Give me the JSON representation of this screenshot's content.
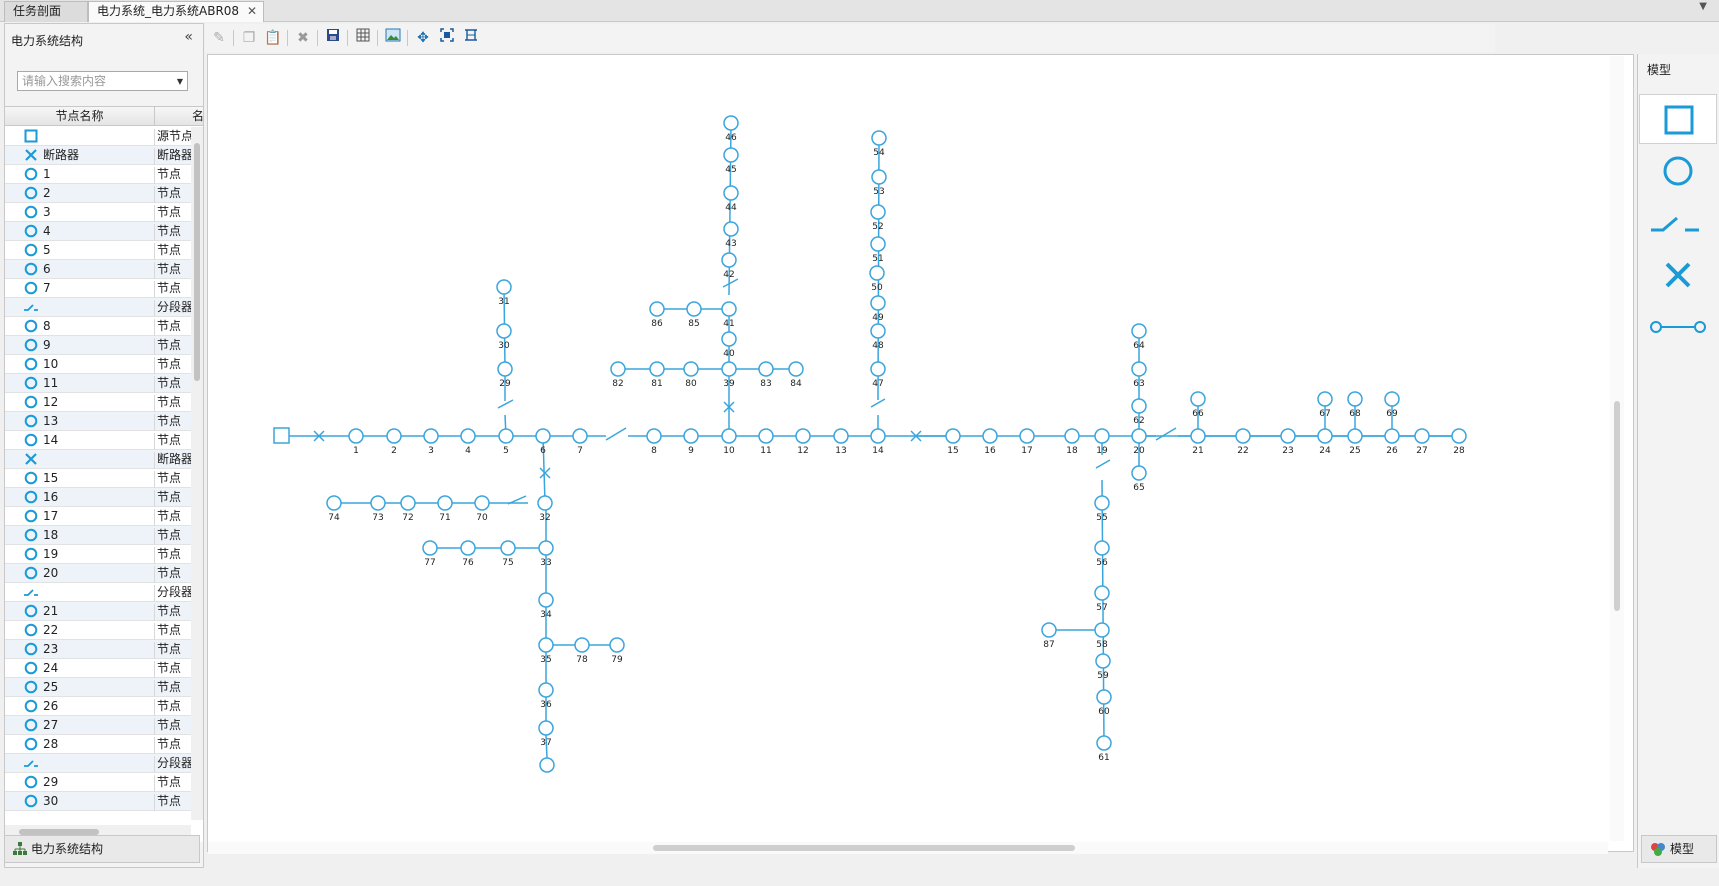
{
  "tabs": [
    {
      "label": "任务剖面"
    },
    {
      "label": "电力系统_电力系统ABR08"
    }
  ],
  "left_panel": {
    "title": "电力系统结构",
    "search_placeholder": "请输入搜索内容",
    "col_name": "节点名称",
    "col_type": "名",
    "rows": [
      {
        "icon": "square",
        "name": "",
        "type": "源节点"
      },
      {
        "icon": "x",
        "name": "断路器",
        "type": "断路器"
      },
      {
        "icon": "circle",
        "name": "1",
        "type": "节点"
      },
      {
        "icon": "circle",
        "name": "2",
        "type": "节点"
      },
      {
        "icon": "circle",
        "name": "3",
        "type": "节点"
      },
      {
        "icon": "circle",
        "name": "4",
        "type": "节点"
      },
      {
        "icon": "circle",
        "name": "5",
        "type": "节点"
      },
      {
        "icon": "circle",
        "name": "6",
        "type": "节点"
      },
      {
        "icon": "circle",
        "name": "7",
        "type": "节点"
      },
      {
        "icon": "switch",
        "name": "",
        "type": "分段器"
      },
      {
        "icon": "circle",
        "name": "8",
        "type": "节点"
      },
      {
        "icon": "circle",
        "name": "9",
        "type": "节点"
      },
      {
        "icon": "circle",
        "name": "10",
        "type": "节点"
      },
      {
        "icon": "circle",
        "name": "11",
        "type": "节点"
      },
      {
        "icon": "circle",
        "name": "12",
        "type": "节点"
      },
      {
        "icon": "circle",
        "name": "13",
        "type": "节点"
      },
      {
        "icon": "circle",
        "name": "14",
        "type": "节点"
      },
      {
        "icon": "x",
        "name": "",
        "type": "断路器"
      },
      {
        "icon": "circle",
        "name": "15",
        "type": "节点"
      },
      {
        "icon": "circle",
        "name": "16",
        "type": "节点"
      },
      {
        "icon": "circle",
        "name": "17",
        "type": "节点"
      },
      {
        "icon": "circle",
        "name": "18",
        "type": "节点"
      },
      {
        "icon": "circle",
        "name": "19",
        "type": "节点"
      },
      {
        "icon": "circle",
        "name": "20",
        "type": "节点"
      },
      {
        "icon": "switch",
        "name": "",
        "type": "分段器"
      },
      {
        "icon": "circle",
        "name": "21",
        "type": "节点"
      },
      {
        "icon": "circle",
        "name": "22",
        "type": "节点"
      },
      {
        "icon": "circle",
        "name": "23",
        "type": "节点"
      },
      {
        "icon": "circle",
        "name": "24",
        "type": "节点"
      },
      {
        "icon": "circle",
        "name": "25",
        "type": "节点"
      },
      {
        "icon": "circle",
        "name": "26",
        "type": "节点"
      },
      {
        "icon": "circle",
        "name": "27",
        "type": "节点"
      },
      {
        "icon": "circle",
        "name": "28",
        "type": "节点"
      },
      {
        "icon": "switch",
        "name": "",
        "type": "分段器"
      },
      {
        "icon": "circle",
        "name": "29",
        "type": "节点"
      },
      {
        "icon": "circle",
        "name": "30",
        "type": "节点"
      }
    ],
    "footer": "电力系统结构"
  },
  "right_panel": {
    "title": "模型",
    "items": [
      {
        "icon": "square-model-icon"
      },
      {
        "icon": "circle-model-icon"
      },
      {
        "icon": "switch-model-icon"
      },
      {
        "icon": "breaker-model-icon"
      },
      {
        "icon": "line-model-icon"
      }
    ],
    "footer": "模型"
  },
  "toolbar": {
    "icons": [
      "edit-icon",
      "copy-icon",
      "paste-icon",
      "delete-icon",
      "save-icon",
      "table-icon",
      "image-icon",
      "fit-icon",
      "zoom-fit-icon",
      "align-icon"
    ]
  },
  "colors": {
    "accent": "#1a9ad6",
    "line": "#3aa5dc"
  },
  "diagram": {
    "node_labels": [
      "1",
      "2",
      "3",
      "4",
      "5",
      "6",
      "7",
      "8",
      "9",
      "10",
      "11",
      "12",
      "13",
      "14",
      "15",
      "16",
      "17",
      "18",
      "19",
      "20",
      "21",
      "22",
      "23",
      "24",
      "25",
      "26",
      "27",
      "28",
      "29",
      "30",
      "31",
      "32",
      "33",
      "34",
      "35",
      "36",
      "37",
      "39",
      "40",
      "41",
      "42",
      "43",
      "44",
      "45",
      "46",
      "47",
      "48",
      "49",
      "50",
      "51",
      "52",
      "53",
      "54",
      "55",
      "56",
      "57",
      "58",
      "59",
      "60",
      "61",
      "62",
      "63",
      "64",
      "65",
      "66",
      "67",
      "68",
      "69",
      "70",
      "71",
      "72",
      "73",
      "74",
      "75",
      "76",
      "77",
      "78",
      "79",
      "80",
      "81",
      "82",
      "83",
      "84",
      "85",
      "86",
      "87"
    ]
  }
}
